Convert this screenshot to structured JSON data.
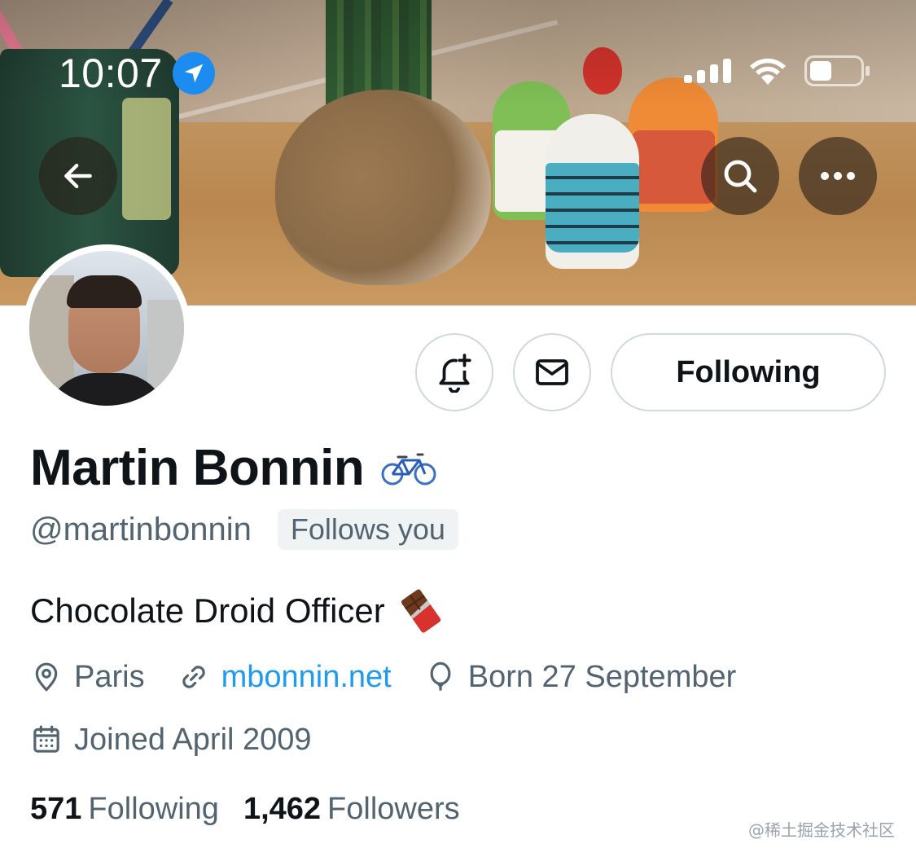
{
  "status_bar": {
    "time": "10:07",
    "icons": [
      "location-arrow-icon",
      "cellular-signal-icon",
      "wifi-icon",
      "battery-icon"
    ]
  },
  "header": {
    "banner": "desk-with-plant-and-android-figurines",
    "buttons": [
      "back-arrow-icon",
      "search-icon",
      "more-dots-icon"
    ]
  },
  "actions": {
    "notify_icon": "bell-plus-icon",
    "message_icon": "envelope-icon",
    "following_label": "Following"
  },
  "profile": {
    "display_name": "Martin Bonnin",
    "name_emoji": "🚲",
    "handle": "@martinbonnin",
    "follows_you": "Follows you",
    "bio": "Chocolate Droid Officer",
    "bio_emoji": "🍫",
    "location": "Paris",
    "website": "mbonnin.net",
    "birthday": "Born 27 September",
    "joined": "Joined April 2009",
    "following_count": "571",
    "following_label": "Following",
    "followers_count": "1,462",
    "followers_label": "Followers"
  },
  "colors": {
    "link": "#1d9bf0",
    "secondary_text": "#536471",
    "primary_text": "#0f1419",
    "border": "#cfd9de",
    "badge_bg": "#eff3f4"
  },
  "watermark": "@稀土掘金技术社区"
}
